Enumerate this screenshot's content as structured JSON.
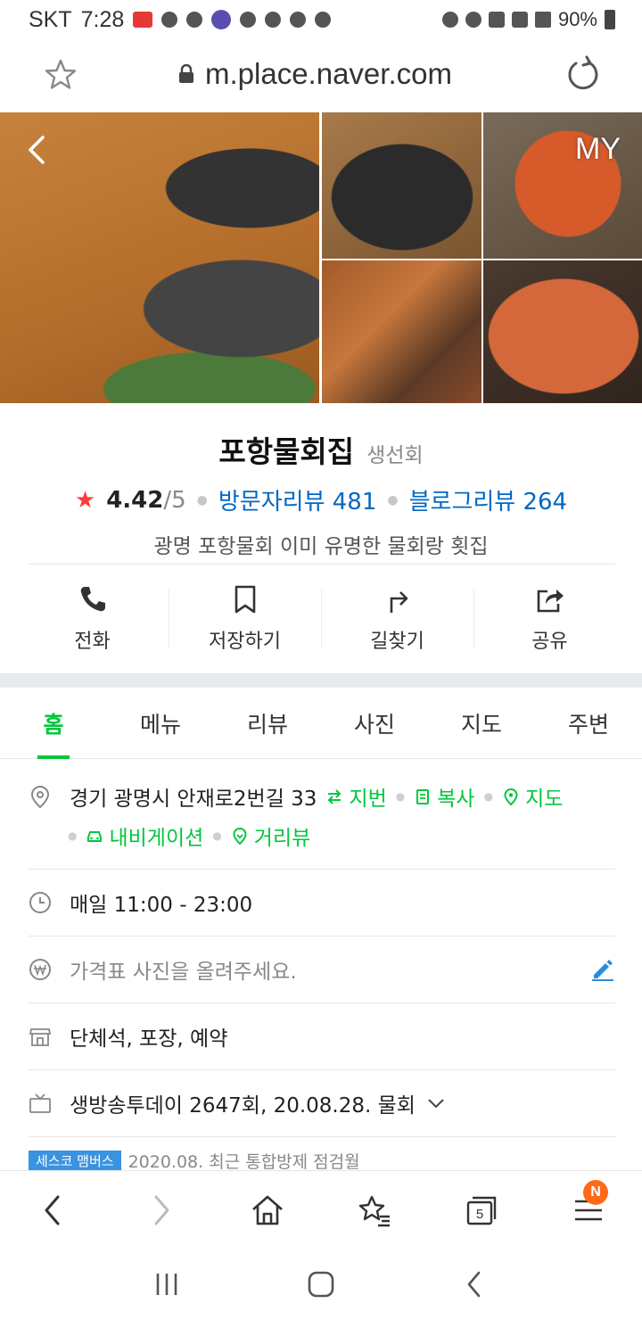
{
  "status_bar": {
    "carrier": "SKT",
    "time": "7:28",
    "battery": "90%"
  },
  "browser": {
    "url": "m.place.naver.com"
  },
  "photo_grid": {
    "my_label": "MY"
  },
  "place": {
    "name": "포항물회집",
    "category": "생선회",
    "rating": "4.42",
    "rating_max": "/5",
    "visitor_reviews": "방문자리뷰 481",
    "blog_reviews": "블로그리뷰 264",
    "description": "광명 포항물회 이미 유명한 물회랑 횟집"
  },
  "actions": [
    {
      "label": "전화",
      "icon": "phone-icon"
    },
    {
      "label": "저장하기",
      "icon": "bookmark-icon"
    },
    {
      "label": "길찾기",
      "icon": "directions-icon"
    },
    {
      "label": "공유",
      "icon": "share-icon"
    }
  ],
  "tabs": [
    {
      "label": "홈",
      "active": true
    },
    {
      "label": "메뉴"
    },
    {
      "label": "리뷰"
    },
    {
      "label": "사진"
    },
    {
      "label": "지도"
    },
    {
      "label": "주변"
    }
  ],
  "info": {
    "address": "경기 광명시 안재로2번길 33",
    "address_links": {
      "jibun": "지번",
      "copy": "복사",
      "map": "지도",
      "navigation": "내비게이션",
      "street_view": "거리뷰"
    },
    "hours": "매일 11:00 - 23:00",
    "price_placeholder": "가격표 사진을 올려주세요.",
    "facilities": "단체석, 포장, 예약",
    "tv": "생방송투데이 2647회, 20.08.28. 물회"
  },
  "teaser": {
    "badge": "세스코 맴버스",
    "text": "2020.08. 최근 통합방제 점검월"
  },
  "bottom_nav": {
    "tabs_count": "5",
    "notification_badge": "N"
  },
  "colors": {
    "accent_green": "#00c73c",
    "link_blue": "#0068c3",
    "star_red": "#ff3b3b",
    "badge_orange": "#ff6a1a"
  }
}
